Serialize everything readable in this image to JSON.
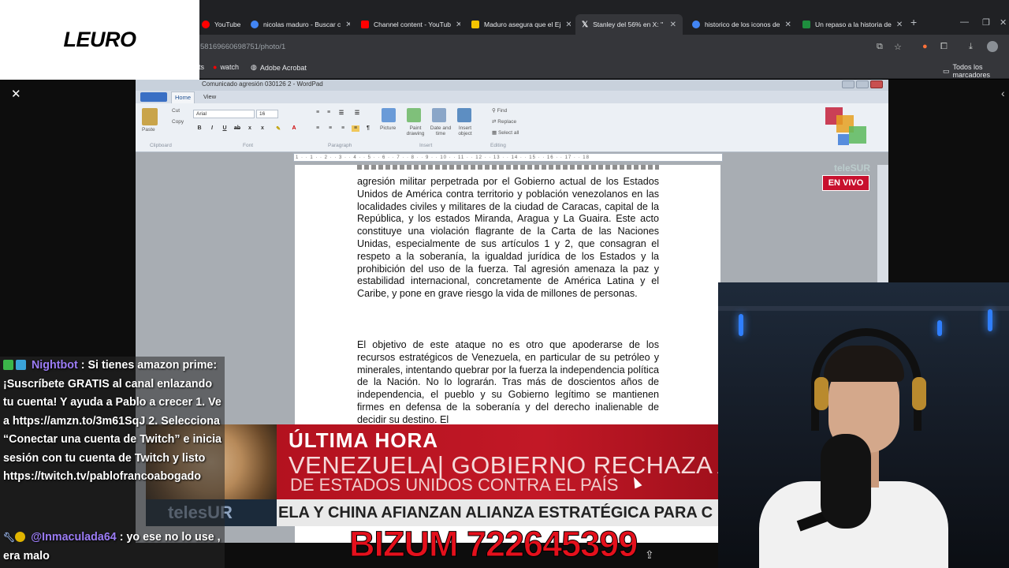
{
  "logo": {
    "text": "LEURO"
  },
  "browser": {
    "tabs": [
      {
        "label": "YouTube",
        "icon_color": "#ff0000"
      },
      {
        "label": "nicolas maduro - Buscar c",
        "icon_color": "#4285f4"
      },
      {
        "label": "Channel content - YouTub",
        "icon_color": "#ff0000"
      },
      {
        "label": "Maduro asegura que el Ej",
        "icon_color": "#f5c400"
      },
      {
        "label": "Stanley del 56% en X: \"",
        "icon_color": "#e8eaed",
        "active": true
      },
      {
        "label": "historico de los iconos de",
        "icon_color": "#4285f4"
      },
      {
        "label": "Un repaso a la historia de",
        "icon_color": "#1e8e3e"
      }
    ],
    "url": "58169660698751/photo/1",
    "bookmarks": [
      {
        "label": "ts"
      },
      {
        "label": "watch"
      },
      {
        "label": "Adobe Acrobat"
      }
    ],
    "bookmarks_right": "Todos los marcadores"
  },
  "wordpad": {
    "title": "Comunicado agresión 030126 2 - WordPad",
    "tabs": {
      "home": "Home",
      "view": "View"
    },
    "ribbon": {
      "paste": "Paste",
      "cut": "Cut",
      "copy": "Copy",
      "clipboard": "Clipboard",
      "font_name": "Arial",
      "font_size": "16",
      "font_group": "Font",
      "paragraph_group": "Paragraph",
      "picture": "Picture",
      "paint_drawing": "Paint drawing",
      "date_time": "Date and time",
      "insert_object": "Insert object",
      "insert_group": "Insert",
      "find": "Find",
      "replace": "Replace",
      "select_all": "Select all",
      "editing_group": "Editing"
    },
    "ruler": "1 · · 1 · · 2 · · 3 · · 4 · · 5 · · 6 · · 7 · · 8 · · 9 · · 10 · · 11 · · 12 · · 13 · · 14 · · 15 · · 16 · · 17 · · 18",
    "paragraphs": [
      "agresión militar perpetrada por el Gobierno actual de los Estados Unidos de América contra territorio y población venezolanos en las localidades civiles y militares de la ciudad de Caracas, capital de la República, y los estados Miranda, Aragua y La Guaira. Este acto constituye una violación flagrante de la Carta de las Naciones Unidas, especialmente de sus artículos 1 y 2, que consagran el respeto a la soberanía, la igualdad jurídica de los Estados y la prohibición del uso de la fuerza. Tal agresión amenaza la paz y estabilidad internacional, concretamente de América Latina y el Caribe, y pone en grave riesgo la vida de millones de personas.",
      "El objetivo de este ataque no es otro que apoderarse de los recursos estratégicos de Venezuela, en particular de su petróleo y minerales, intentando quebrar por la fuerza la independencia política de la Nación. No lo lograrán. Tras más de doscientos años de independencia, el pueblo y su Gobierno legítimo se mantienen firmes en defensa de la soberanía y del derecho inalienable de decidir su destino. El"
    ]
  },
  "broadcast": {
    "channel": "teleSUR",
    "live": "EN VIVO",
    "breaking": "ÚLTIMA HORA",
    "headline_1": "VENEZUELA| GOBIERNO RECHAZA A",
    "headline_2": "DE ESTADOS UNIDOS CONTRA EL PAÍS",
    "lower_channel": "telesUR",
    "ticker": "ELA Y CHINA AFIANZAN ALIANZA ESTRATÉGICA PARA C"
  },
  "chat": {
    "messages": [
      {
        "user": "Nightbot",
        "text": ": Si tienes amazon prime: ¡Suscríbete GRATIS al canal enlazando tu cuenta! Y ayuda a Pablo a crecer 1. Ve a https://amzn.to/3m61SqJ 2. Selecciona “Conectar una cuenta de Twitch” e inicia sesión con tu cuenta de Twitch y listo https://twitch.tv/pablofrancoabogado"
      },
      {
        "user": "@Inmaculada64",
        "text": ": yo ese no lo use , era malo"
      }
    ]
  },
  "donation": {
    "text": "BIZUM 722645399"
  }
}
